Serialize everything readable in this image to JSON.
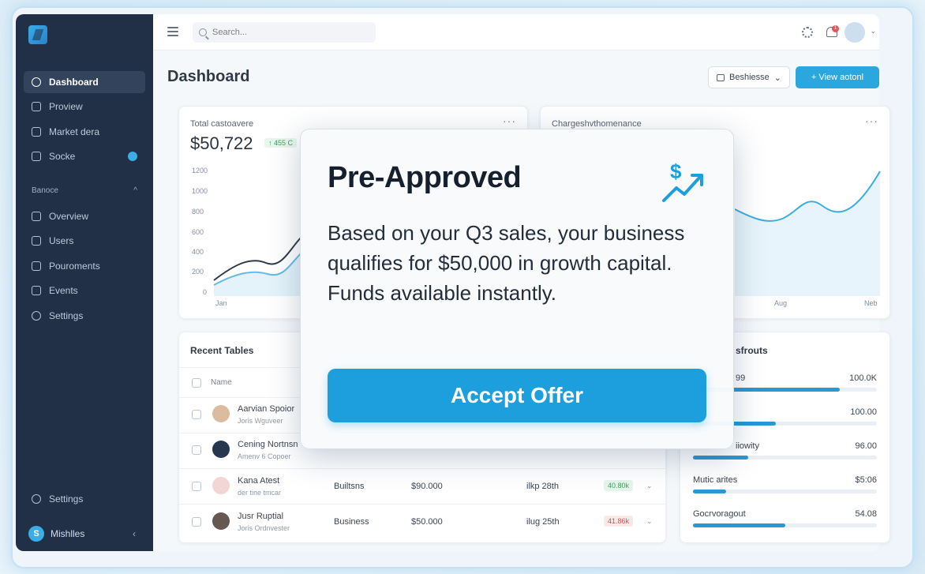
{
  "sidebar": {
    "items": [
      {
        "label": "Dashboard",
        "active": true
      },
      {
        "label": "Proview"
      },
      {
        "label": "Market dera"
      },
      {
        "label": "Socke",
        "badge": true
      },
      {
        "label": "Overview"
      },
      {
        "label": "Users"
      },
      {
        "label": "Pouroments"
      },
      {
        "label": "Events"
      },
      {
        "label": "Settings"
      }
    ],
    "section_label": "Banoce",
    "section_caret": "^",
    "bottom_settings": "Settings",
    "user_initial": "S",
    "user_name": "Mishlles",
    "collapse_glyph": "‹"
  },
  "topbar": {
    "search_placeholder": "Search...",
    "notification_count": "1",
    "avatar_caret": "⌄"
  },
  "header": {
    "title": "Dashboard",
    "business_select": "Beshiesse",
    "select_caret": "⌄",
    "view_button": "+ View aotonl"
  },
  "stat_card": {
    "label": "Total castoavere",
    "value": "$50,722",
    "delta": "↑ 455 C",
    "more": "···",
    "y_ticks": [
      "1200",
      "1000",
      "800",
      "600",
      "400",
      "200",
      "0"
    ],
    "x_tick_first": "Jan"
  },
  "perf_card": {
    "label": "Chargeshvthomenance",
    "more": "···",
    "x_ticks": [
      "Aug",
      "Neb"
    ]
  },
  "table": {
    "title": "Recent Tables",
    "name_header": "Name",
    "rows": [
      {
        "name": "Aarvian Spoior",
        "sub": "Joris Wguveer",
        "type": "",
        "amount": "",
        "date": "",
        "delta": "",
        "delta_color": "green"
      },
      {
        "name": "Cening Nortnsn",
        "sub": "Amenv 6 Copoer",
        "type": "",
        "amount": "",
        "date": "",
        "delta": "",
        "delta_color": "green"
      },
      {
        "name": "Kana Atest",
        "sub": "der tine tmcar",
        "type": "Builtsns",
        "amount": "$90.000",
        "date": "ilkp 28th",
        "delta": "40.80k",
        "delta_color": "green"
      },
      {
        "name": "Jusr Ruptial",
        "sub": "Joris Ordnvester",
        "type": "Business",
        "amount": "$50.000",
        "date": "ilug 25th",
        "delta": "41.86k",
        "delta_color": "red"
      }
    ],
    "row_caret": "⌄"
  },
  "accounts": {
    "title": "sfrouts",
    "rows": [
      {
        "label": "99",
        "value": "100.0K",
        "fill": 0.8
      },
      {
        "label": "",
        "value": "100.00",
        "fill": 0.45
      },
      {
        "label": "iiowity",
        "value": "96.00",
        "fill": 0.3
      },
      {
        "label": "Mutic arites",
        "value": "$5:06",
        "fill": 0.18
      },
      {
        "label": "Gocrvoragout",
        "value": "54.08",
        "fill": 0.5
      }
    ]
  },
  "modal": {
    "title": "Pre-Approved",
    "body": "Based on your Q3 sales, your business qualifies for $50,000 in growth capital. Funds available instantly.",
    "accept_label": "Accept Offer",
    "icon_symbol": "$"
  },
  "colors": {
    "accent": "#1c9fdc",
    "sidebar": "#0f1f38",
    "positive": "#2a9b54",
    "negative": "#d14545"
  }
}
